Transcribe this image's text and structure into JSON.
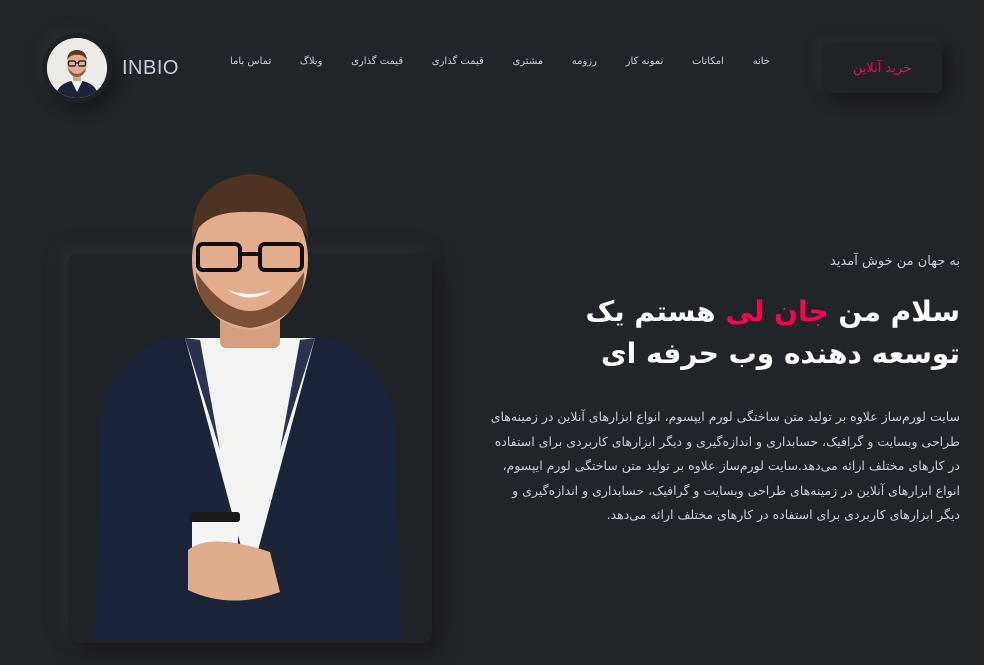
{
  "brand": {
    "name": "INBIO"
  },
  "nav": {
    "items": [
      {
        "label": "خانه"
      },
      {
        "label": "امکانات"
      },
      {
        "label": "نمونه کار"
      },
      {
        "label": "رزومه"
      },
      {
        "label": "مشتری"
      },
      {
        "label": "قیمت گذاری"
      },
      {
        "label": "قیمت گذاری"
      },
      {
        "label": "وبلاگ"
      },
      {
        "label": "تماس باما"
      }
    ]
  },
  "header": {
    "buy_label": "خرید آنلاین"
  },
  "hero": {
    "welcome": "به جهان من خوش آمدید",
    "headline_pre": "سلام من ",
    "headline_name": "جان لی",
    "headline_post": " هستم یک",
    "headline_line2": "توسعه دهنده وب حرفه ای",
    "description": "سایت لورم‌ساز علاوه بر تولید متن ساختگی لورم ایپسوم، انواع ابزارهای آنلاین در زمینه‌های طراحی وبسایت و گرافیک، حسابداری و اندازه‌گیری و دیگر ابزارهای کاربردی برای استفاده در کارهای مختلف ارائه می‌دهد.سایت لورم‌ساز علاوه بر تولید متن ساختگی لورم ایپسوم، انواع ابزارهای آنلاین در زمینه‌های طراحی وبسایت و گرافیک، حسابداری و اندازه‌گیری و دیگر ابزارهای کاربردی برای استفاده در کارهای مختلف ارائه می‌دهد."
  },
  "colors": {
    "background": "#212428",
    "accent": "#ff014f",
    "text": "#c4cfde",
    "heading": "#ffffff"
  }
}
